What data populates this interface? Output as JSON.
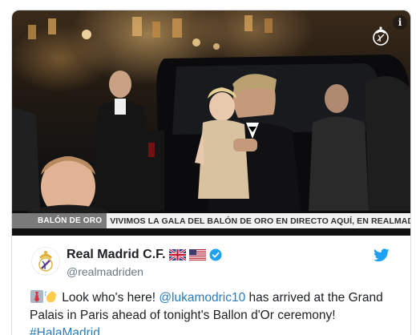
{
  "video": {
    "ticker_label": "BALÓN DE ORO",
    "ticker_text": "VIVIMOS LA GALA DEL BALÓN DE ORO EN DIRECTO AQUÍ, EN REALMADRID TV",
    "info_symbol": "i",
    "watermark_icon": "real-madrid-crest-icon"
  },
  "author": {
    "name": "Real Madrid C.F.",
    "handle": "@realmadriden",
    "avatar_icon": "real-madrid-crest-icon",
    "flags": [
      "uk-flag-icon",
      "us-flag-icon"
    ],
    "verified_icon": "verified-badge-icon"
  },
  "tweet": {
    "emoji": [
      "necktie-emoji-icon",
      "waving-hand-emoji-icon"
    ],
    "text_before": " Look who's here! ",
    "mention": "@lukamodric10",
    "text_after": " has arrived at the Grand Palais in Paris ahead of tonight's Ballon d'Or ceremony!",
    "hashtag": "#HalaMadrid"
  },
  "colors": {
    "link": "#2b7bb9",
    "twitter_blue": "#1da1f2",
    "verified": "#1da1f2",
    "text": "#1c2022",
    "muted": "#697882"
  }
}
